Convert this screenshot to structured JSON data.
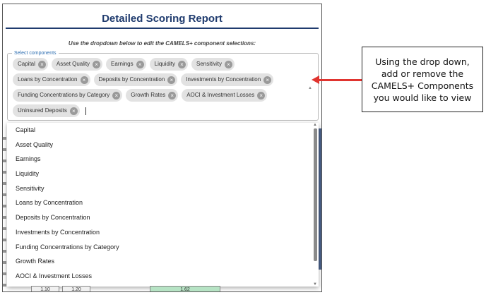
{
  "report": {
    "title": "Detailed Scoring Report",
    "instruction": "Use the dropdown below to edit the CAMELS+ component selections:"
  },
  "select": {
    "label": "Select components",
    "selected": [
      "Capital",
      "Asset Quality",
      "Earnings",
      "Liquidity",
      "Sensitivity",
      "Loans by Concentration",
      "Deposits by Concentration",
      "Investments by Concentration",
      "Funding Concentrations by Category",
      "Growth Rates",
      "AOCI & Investment Losses",
      "Uninsured Deposits"
    ]
  },
  "dropdown": {
    "options": [
      "Capital",
      "Asset Quality",
      "Earnings",
      "Liquidity",
      "Sensitivity",
      "Loans by Concentration",
      "Deposits by Concentration",
      "Investments by Concentration",
      "Funding Concentrations by Category",
      "Growth Rates",
      "AOCI & Investment Losses"
    ]
  },
  "bottom_row": {
    "cells": [
      "1.10",
      "1.20",
      "1.62"
    ]
  },
  "callout": {
    "text": "Using the drop down, add or remove the CAMELS+ Components you would like to view"
  },
  "colors": {
    "title": "#1f3b6e",
    "chip_bg": "#e2e2e2",
    "arrow": "#e0342f",
    "legend": "#2b6cb0"
  }
}
